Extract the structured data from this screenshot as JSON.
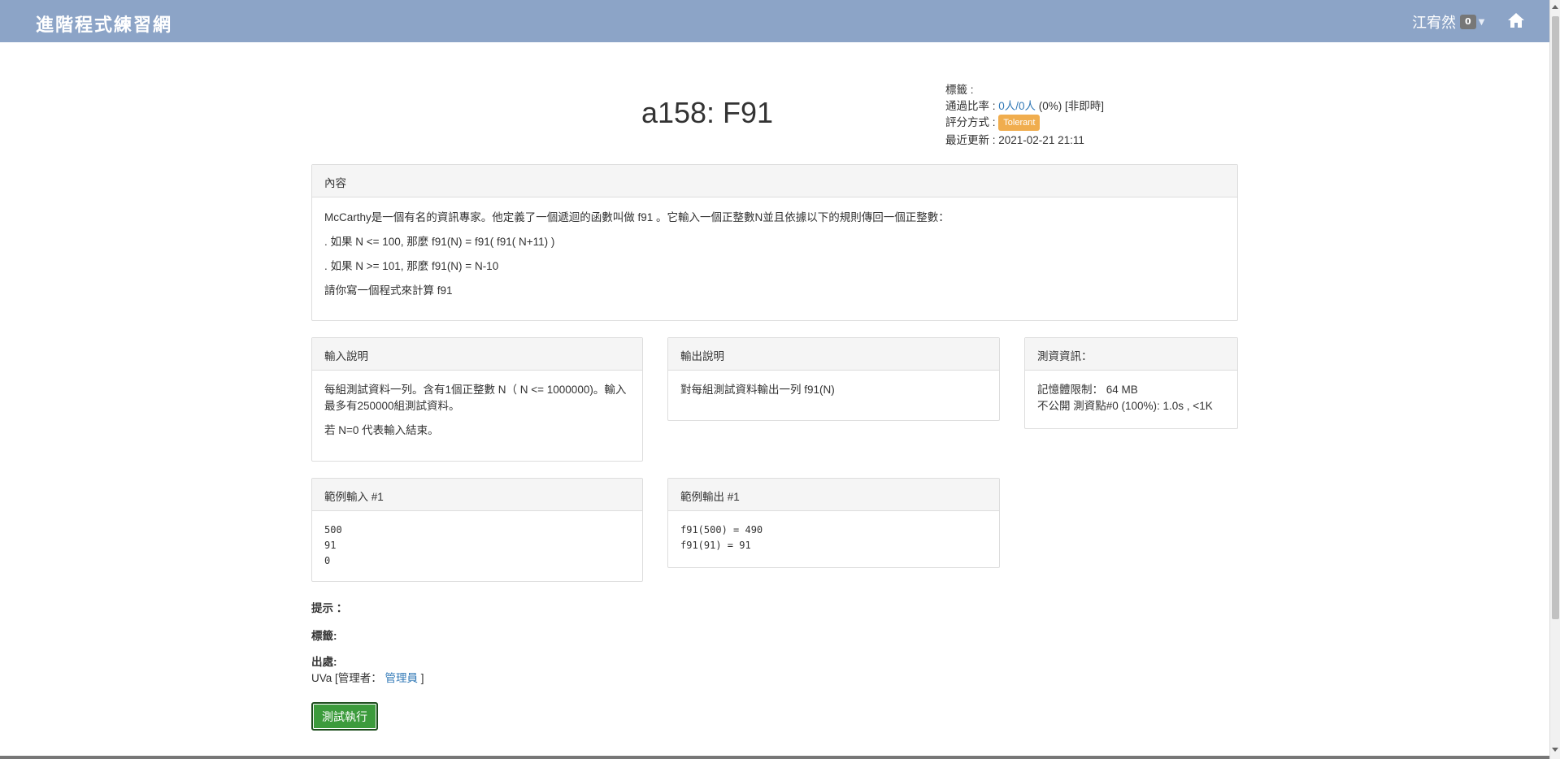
{
  "navbar": {
    "brand": "進階程式練習網",
    "user_name": "江宥然",
    "user_badge": "0"
  },
  "problem": {
    "title": "a158: F91",
    "meta": {
      "tags_label": "標籤 :",
      "pass_rate_label": "通過比率 : ",
      "pass_rate_link": "0人/0人",
      "pass_rate_rest": " (0%) [非即時]",
      "scoring_label": "評分方式 : ",
      "scoring_value": "Tolerant",
      "updated_label": "最近更新 : ",
      "updated_value": "2021-02-21 21:11"
    }
  },
  "content_panel": {
    "heading": "內容",
    "paragraphs": [
      "McCarthy是一個有名的資訊專家。他定義了一個遞迴的函數叫做 f91 。它輸入一個正整數N並且依據以下的規則傳回一個正整數：",
      ". 如果 N <= 100, 那麼 f91(N) = f91( f91( N+11) )",
      ". 如果 N >= 101, 那麼 f91(N) = N-10",
      "請你寫一個程式來計算 f91"
    ]
  },
  "input_panel": {
    "heading": "輸入說明",
    "paragraphs": [
      "每組測試資料一列。含有1個正整數 N（ N <= 1000000)。輸入最多有250000組測試資料。",
      "若 N=0 代表輸入結束。"
    ]
  },
  "output_panel": {
    "heading": "輸出說明",
    "paragraphs": [
      "對每組測試資料輸出一列 f91(N)"
    ]
  },
  "test_panel": {
    "heading": "測資資訊：",
    "memory": "記憶體限制： 64 MB",
    "cases": "不公開 測資點#0 (100%): 1.0s , <1K"
  },
  "sample_input": {
    "heading": "範例輸入 #1",
    "text": "500\n91\n0"
  },
  "sample_output": {
    "heading": "範例輸出 #1",
    "text": "f91(500) = 490\nf91(91) = 91"
  },
  "footer": {
    "hint_label": "提示 ：",
    "tags_label": "標籤:",
    "source_label": "出處:",
    "source_prefix": "UVa [管理者：",
    "source_link": "管理員",
    "source_suffix": "]",
    "run_button": "測試執行"
  },
  "icons": {
    "home": "home-icon",
    "caret": "caret-down-icon"
  },
  "colors": {
    "navbar": "#8ca4c7",
    "link": "#337ab7",
    "tolerant_label": "#f0ad4e",
    "run_button": "#3c9b3c"
  }
}
